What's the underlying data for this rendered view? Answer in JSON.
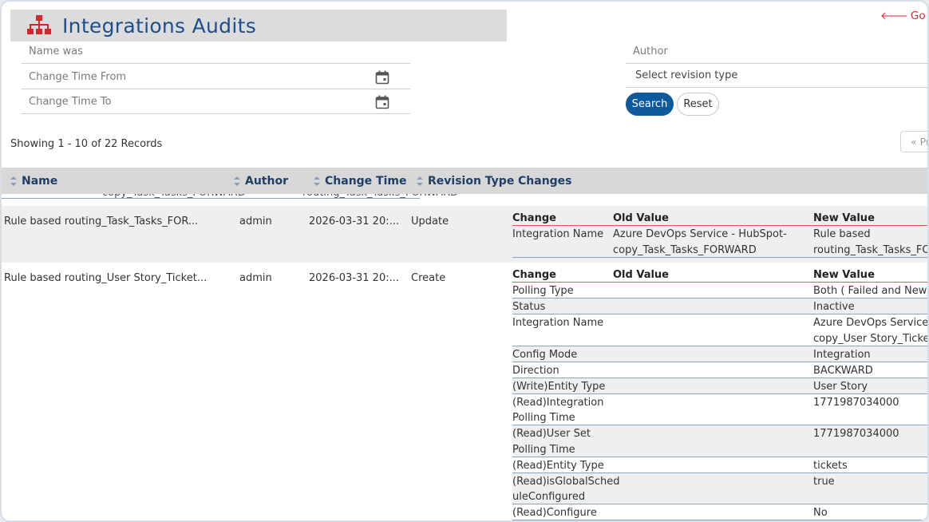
{
  "header": {
    "title": "Integrations Audits",
    "icon": "sitemap-icon",
    "go_back": "Go back"
  },
  "filters": {
    "name_was": "Name was",
    "change_time_from": "Change Time From",
    "change_time_to": "Change Time To",
    "author": "Author",
    "revision_type": "Select revision type",
    "search_label": "Search",
    "reset_label": "Reset"
  },
  "records_text": "Showing 1 - 10 of 22 Records",
  "pager_prev": "« Previous",
  "columns": [
    "Name",
    "Author",
    "Change Time",
    "Revision Type",
    "Changes"
  ],
  "partial_row": {
    "old": "copy_Task_Tasks_FORWARD",
    "new": "routing_Task_Tasks_FORWARD"
  },
  "rows": [
    {
      "name": "Rule based routing_Task_Tasks_FOR...",
      "author": "admin",
      "change_time": "2026-03-31 20:...",
      "revision_type": "Update",
      "changes_header": [
        "Change",
        "Old Value",
        "New Value"
      ],
      "changes": [
        {
          "change": "Integration Name",
          "old": [
            "Azure DevOps Service - HubSpot-",
            "copy_Task_Tasks_FORWARD"
          ],
          "new": [
            "Rule based",
            "routing_Task_Tasks_FORWARD"
          ]
        }
      ]
    },
    {
      "name": "Rule based routing_User Story_Ticket...",
      "author": "admin",
      "change_time": "2026-03-31 20:...",
      "revision_type": "Create",
      "changes_header": [
        "Change",
        "Old Value",
        "New Value"
      ],
      "changes": [
        {
          "change": [
            "Polling Type"
          ],
          "old": [
            ""
          ],
          "new": [
            "Both ( Failed and New events )"
          ]
        },
        {
          "change": [
            "Status"
          ],
          "old": [
            ""
          ],
          "new": [
            "Inactive"
          ]
        },
        {
          "change": [
            "Integration Name"
          ],
          "old": [
            ""
          ],
          "new": [
            "Azure DevOps Service -",
            "copy_User Story_Tickets"
          ]
        },
        {
          "change": [
            "Config Mode"
          ],
          "old": [
            ""
          ],
          "new": [
            "Integration"
          ]
        },
        {
          "change": [
            "Direction"
          ],
          "old": [
            ""
          ],
          "new": [
            "BACKWARD"
          ]
        },
        {
          "change": [
            "(Write)Entity Type"
          ],
          "old": [
            ""
          ],
          "new": [
            "User Story"
          ]
        },
        {
          "change": [
            "(Read)Integration",
            "Polling Time"
          ],
          "old": [
            ""
          ],
          "new": [
            "1771987034000"
          ]
        },
        {
          "change": [
            "(Read)User Set",
            "Polling Time"
          ],
          "old": [
            ""
          ],
          "new": [
            "1771987034000"
          ]
        },
        {
          "change": [
            "(Read)Entity Type"
          ],
          "old": [
            ""
          ],
          "new": [
            "tickets"
          ]
        },
        {
          "change": [
            "(Read)isGlobalSched",
            "uleConfigured"
          ],
          "old": [
            ""
          ],
          "new": [
            "true"
          ]
        },
        {
          "change": [
            "(Read)Configure"
          ],
          "old": [
            ""
          ],
          "new": [
            "No"
          ]
        }
      ]
    }
  ],
  "colors": {
    "title": "#1f4e8c",
    "accent": "#0f5a9c",
    "go_back": "#e0262b",
    "icon": "#d7262b"
  }
}
